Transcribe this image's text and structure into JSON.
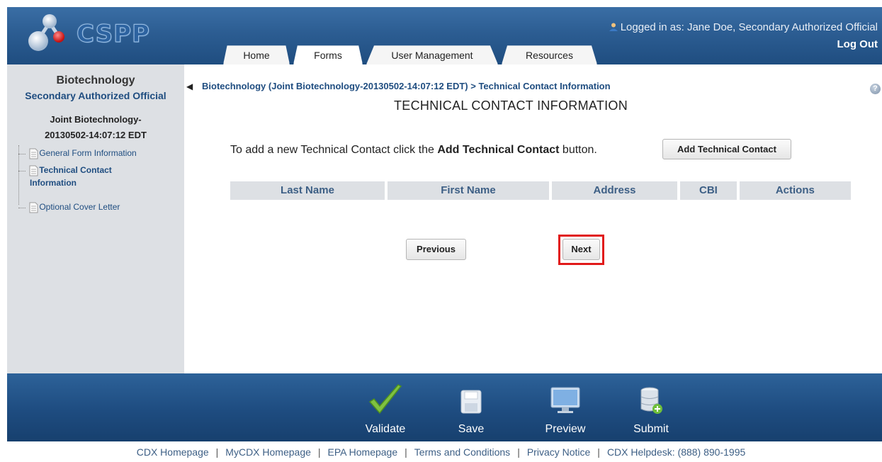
{
  "header": {
    "logo_text": "CSPP",
    "logged_in_text": "Logged in as: Jane Doe, Secondary Authorized Official",
    "logout_label": "Log Out",
    "tabs": [
      {
        "label": "Home",
        "active": false
      },
      {
        "label": "Forms",
        "active": true
      },
      {
        "label": "User Management",
        "active": false
      },
      {
        "label": "Resources",
        "active": false
      }
    ]
  },
  "sidebar": {
    "title": "Biotechnology",
    "subtitle": "Secondary Authorized Official",
    "form_name_line1": "Joint Biotechnology-",
    "form_name_line2": "20130502-14:07:12 EDT",
    "items": [
      {
        "label": "General Form Information",
        "active": false
      },
      {
        "label": "Technical Contact",
        "label2": "Information",
        "active": true
      },
      {
        "label": "Optional Cover Letter",
        "active": false
      }
    ]
  },
  "main": {
    "breadcrumb": "Biotechnology (Joint Biotechnology-20130502-14:07:12 EDT) > Technical Contact Information",
    "title": "TECHNICAL CONTACT INFORMATION",
    "instruction_pre": "To add a new Technical Contact click the ",
    "instruction_bold": "Add Technical Contact",
    "instruction_post": " button.",
    "add_button": "Add Technical Contact",
    "table_headers": [
      "Last Name",
      "First Name",
      "Address",
      "CBI",
      "Actions"
    ],
    "prev_button": "Previous",
    "next_button": "Next"
  },
  "toolbar": {
    "validate": "Validate",
    "save": "Save",
    "preview": "Preview",
    "submit": "Submit"
  },
  "footer_links": [
    "CDX Homepage",
    "MyCDX Homepage",
    "EPA Homepage",
    "Terms and Conditions",
    "Privacy Notice",
    "CDX Helpdesk: (888) 890-1995"
  ],
  "colors": {
    "header_blue": "#2c5d92",
    "sidebar_gray": "#dde0e4",
    "link_blue": "#1f4d80",
    "highlight_red": "#e11a1a"
  }
}
